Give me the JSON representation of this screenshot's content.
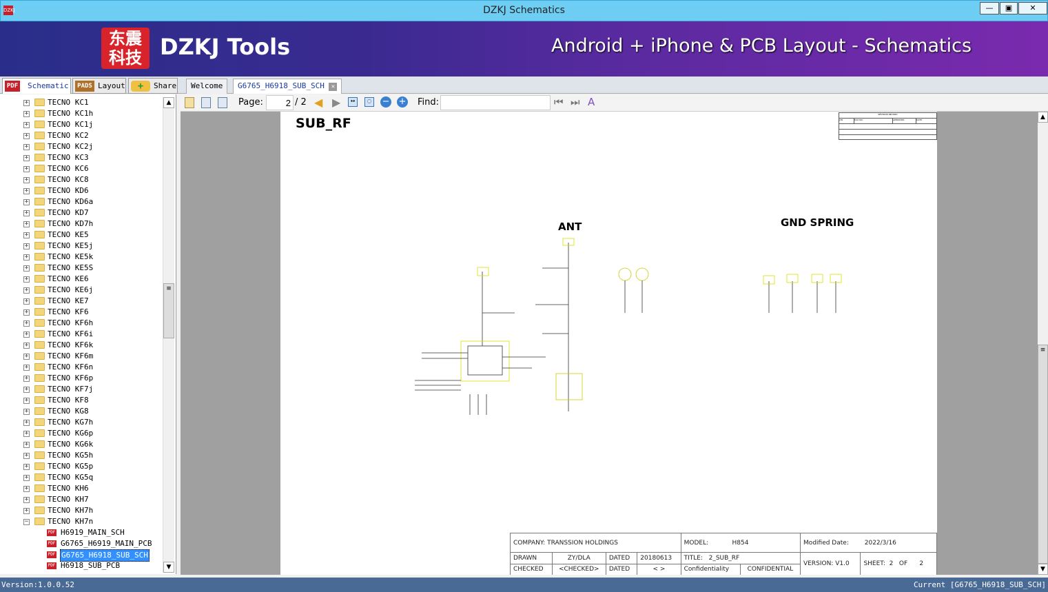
{
  "window": {
    "title": "DZKJ Schematics",
    "app_icon": "DZKJ"
  },
  "banner": {
    "logo_text": "东震科技",
    "brand": "DZKJ Tools",
    "slogan": "Android + iPhone & PCB Layout - Schematics"
  },
  "side_tabs": [
    {
      "label": "Schematic",
      "icon": "PDF"
    },
    {
      "label": "Layout",
      "icon": "PADS"
    },
    {
      "label": "Share",
      "icon": "cloud-plus"
    }
  ],
  "doc_tabs": [
    {
      "label": "Welcome"
    },
    {
      "label": "G6765_H6918_SUB_SCH"
    }
  ],
  "tree": {
    "folders": [
      "TECNO KC1",
      "TECNO KC1h",
      "TECNO KC1j",
      "TECNO KC2",
      "TECNO KC2j",
      "TECNO KC3",
      "TECNO KC6",
      "TECNO KC8",
      "TECNO KD6",
      "TECNO KD6a",
      "TECNO KD7",
      "TECNO KD7h",
      "TECNO KE5",
      "TECNO KE5j",
      "TECNO KE5k",
      "TECNO KE5S",
      "TECNO KE6",
      "TECNO KE6j",
      "TECNO KE7",
      "TECNO KF6",
      "TECNO KF6h",
      "TECNO KF6i",
      "TECNO KF6k",
      "TECNO KF6m",
      "TECNO KF6n",
      "TECNO KF6p",
      "TECNO KF7j",
      "TECNO KF8",
      "TECNO KG8",
      "TECNO KG7h",
      "TECNO KG6p",
      "TECNO KG6k",
      "TECNO KG5h",
      "TECNO KG5p",
      "TECNO KG5q",
      "TECNO KH6",
      "TECNO KH7",
      "TECNO KH7h",
      "TECNO KH7n"
    ],
    "files": [
      "H6919_MAIN_SCH",
      "G6765_H6919_MAIN_PCB",
      "G6765_H6918_SUB_SCH",
      "H6918_SUB_PCB"
    ],
    "selected_file": "G6765_H6918_SUB_SCH"
  },
  "toolbar": {
    "page_label": "Page:",
    "page_value": "2",
    "page_total": "/ 2",
    "find_label": "Find:",
    "find_value": ""
  },
  "schematic": {
    "sheet_title": "SUB_RF",
    "ant_label": "ANT",
    "gnd_label": "GND SPRING",
    "revision": {
      "title": "REVISION RECORD",
      "cols": [
        "LTR",
        "ECO NO:",
        "APPROVED:",
        "DATE:"
      ]
    },
    "title_block": {
      "company": "COMPANY: TRANSSION HOLDINGS",
      "model_label": "MODEL:",
      "model": "H854",
      "modified_label": "Modified Date:",
      "modified": "2022/3/16",
      "drawn_label": "DRAWN",
      "drawn": "ZY/DLA",
      "dated_label": "DATED",
      "dated": "20180613",
      "title_label": "TITLE:",
      "title": "2_SUB_RF",
      "version": "VERSION:  V1.0",
      "sheet_label": "SHEET:",
      "sheet": "2",
      "of_label": "OF",
      "sheet_total": "2",
      "checked_label": "CHECKED",
      "checked": "<CHECKED>",
      "dated2": "< >",
      "conf_label": "Confidentiality",
      "conf": "CONFIDENTIAL"
    }
  },
  "status": {
    "version": "Version:1.0.0.52",
    "current": "Current [G6765_H6918_SUB_SCH]"
  }
}
